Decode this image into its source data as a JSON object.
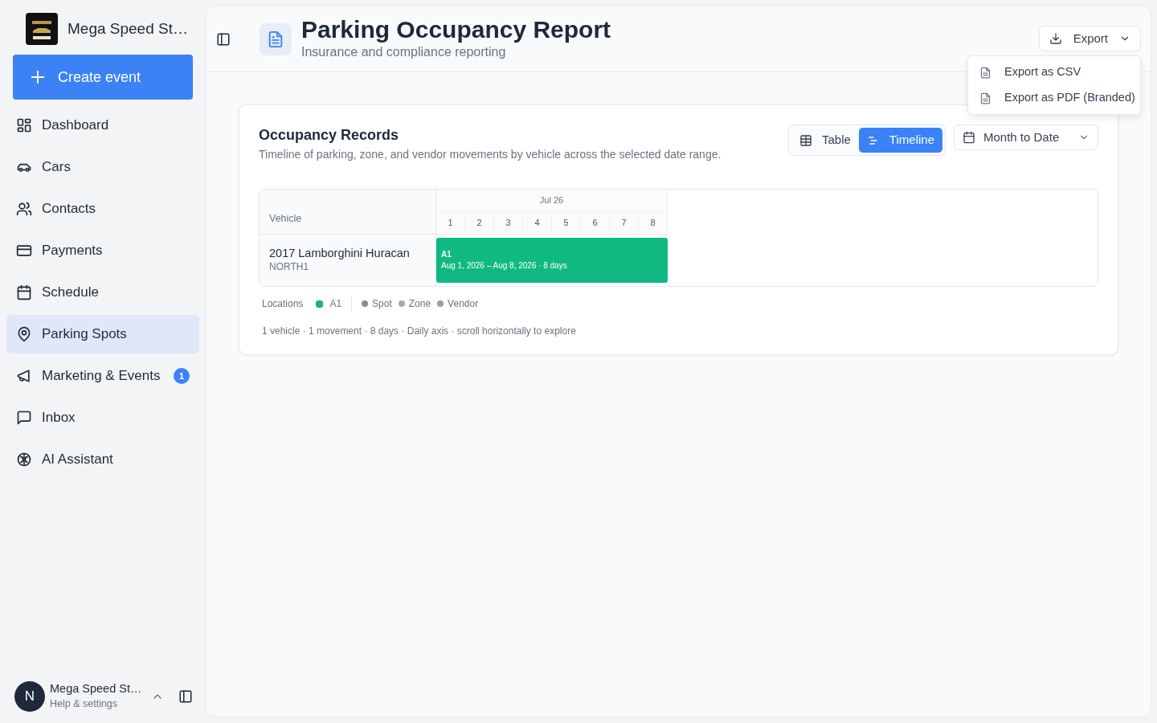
{
  "sidebar": {
    "brand": "Mega Speed St…",
    "create_button": "Create event",
    "items": [
      {
        "label": "Dashboard",
        "selected": false
      },
      {
        "label": "Cars",
        "selected": false
      },
      {
        "label": "Contacts",
        "selected": false
      },
      {
        "label": "Payments",
        "selected": false
      },
      {
        "label": "Schedule",
        "selected": false
      },
      {
        "label": "Parking Spots",
        "selected": true
      },
      {
        "label": "Marketing & Events",
        "selected": false,
        "badge": "1"
      },
      {
        "label": "Inbox",
        "selected": false
      },
      {
        "label": "AI Assistant",
        "selected": false
      }
    ],
    "user": {
      "initial": "N",
      "name": "Mega Speed St…",
      "subtitle": "Help & settings"
    }
  },
  "header": {
    "title": "Parking Occupancy Report",
    "subtitle": "Insurance and compliance reporting",
    "export_button": "Export",
    "export_menu": {
      "expanded": true,
      "items": [
        "Export as CSV",
        "Export as PDF (Branded)"
      ]
    }
  },
  "card": {
    "title": "Occupancy Records",
    "description": "Timeline of parking, zone, and vendor movements by vehicle across the selected date range.",
    "view_toggle": [
      {
        "label": "Table",
        "selected": false
      },
      {
        "label": "Timeline",
        "selected": true
      }
    ],
    "date_range": "Month to Date",
    "timeline": {
      "vehicle_header": "Vehicle",
      "month": "Jul 26",
      "days": [
        "1",
        "2",
        "3",
        "4",
        "5",
        "6",
        "7",
        "8"
      ],
      "rows": [
        {
          "vehicle": "2017 Lamborghini Huracan",
          "plate": "NORTH1",
          "bar": {
            "label": "A1",
            "detail": "Aug 1, 2026 – Aug 8, 2026 · 8 days",
            "color": "#10b981"
          }
        }
      ]
    },
    "legend": {
      "title": "Locations",
      "locations": [
        {
          "label": "A1",
          "color": "#10b981"
        }
      ],
      "types": [
        {
          "label": "Spot",
          "color": "#868a91"
        },
        {
          "label": "Zone",
          "color": "#a4a8ae"
        },
        {
          "label": "Vendor",
          "color": "#989ca2"
        }
      ]
    },
    "summary": "1 vehicle · 1 movement · 8 days · Daily axis · scroll horizontally to explore"
  }
}
